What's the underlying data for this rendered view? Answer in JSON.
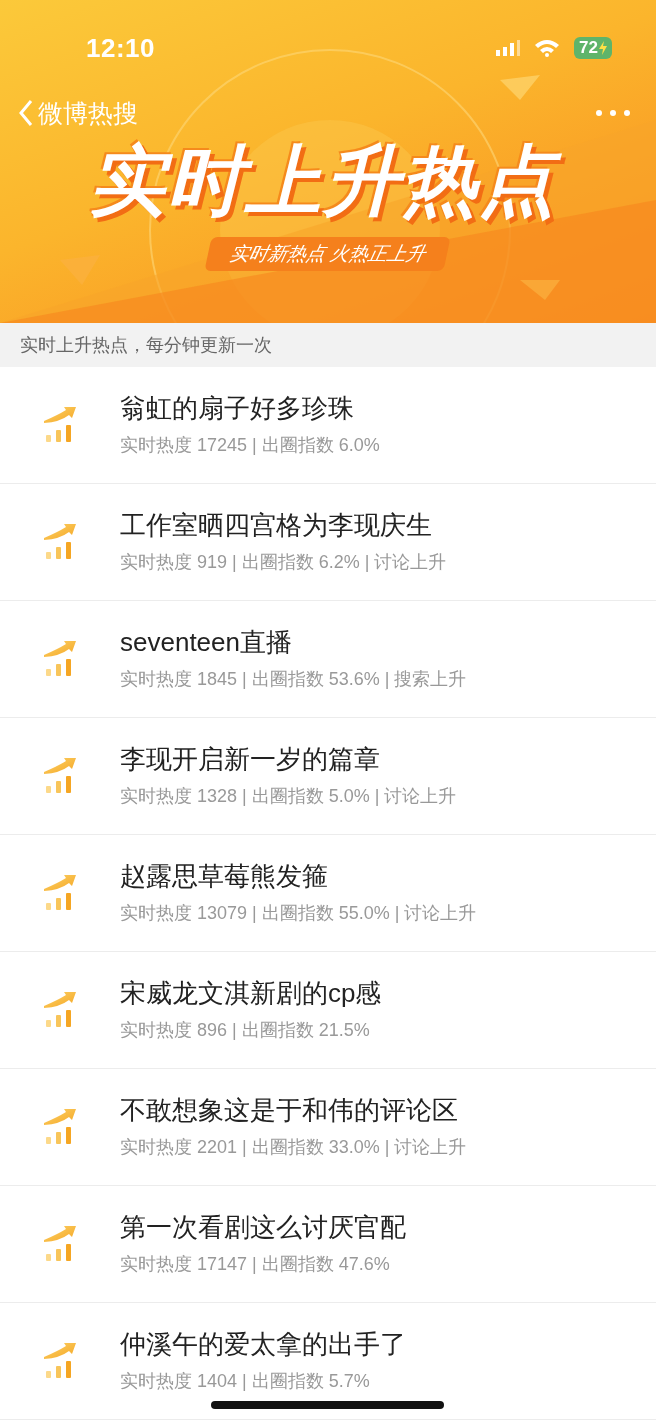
{
  "status_bar": {
    "time": "12:10",
    "battery": "72"
  },
  "nav": {
    "back_label": "微博热搜"
  },
  "banner": {
    "title": "实时上升热点",
    "subtitle": "实时新热点 火热正上升"
  },
  "notice": "实时上升热点，每分钟更新一次",
  "topics": [
    {
      "title": "翁虹的扇子好多珍珠",
      "meta": "实时热度 17245 | 出圈指数 6.0%"
    },
    {
      "title": "工作室晒四宫格为李现庆生",
      "meta": "实时热度 919 | 出圈指数 6.2% | 讨论上升"
    },
    {
      "title": "seventeen直播",
      "meta": "实时热度 1845 | 出圈指数 53.6% | 搜索上升"
    },
    {
      "title": "李现开启新一岁的篇章",
      "meta": "实时热度 1328 | 出圈指数 5.0% | 讨论上升"
    },
    {
      "title": "赵露思草莓熊发箍",
      "meta": "实时热度 13079 | 出圈指数 55.0% | 讨论上升"
    },
    {
      "title": "宋威龙文淇新剧的cp感",
      "meta": "实时热度 896 | 出圈指数 21.5%"
    },
    {
      "title": "不敢想象这是于和伟的评论区",
      "meta": "实时热度 2201 | 出圈指数 33.0% | 讨论上升"
    },
    {
      "title": "第一次看剧这么讨厌官配",
      "meta": "实时热度 17147 | 出圈指数 47.6%"
    },
    {
      "title": "仲溪午的爱太拿的出手了",
      "meta": "实时热度 1404 | 出圈指数 5.7%"
    }
  ]
}
